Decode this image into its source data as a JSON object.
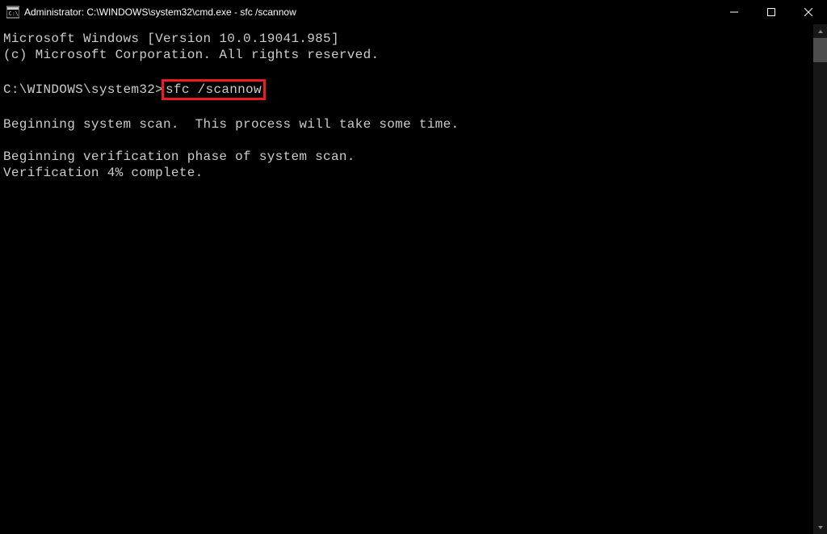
{
  "titlebar": {
    "title": "Administrator: C:\\WINDOWS\\system32\\cmd.exe - sfc  /scannow"
  },
  "terminal": {
    "line1": "Microsoft Windows [Version 10.0.19041.985]",
    "line2": "(c) Microsoft Corporation. All rights reserved.",
    "blank1": "",
    "prompt": "C:\\WINDOWS\\system32>",
    "command": "sfc /scannow",
    "blank2": "",
    "line3": "Beginning system scan.  This process will take some time.",
    "blank3": "",
    "line4": "Beginning verification phase of system scan.",
    "line5": "Verification 4% complete."
  }
}
